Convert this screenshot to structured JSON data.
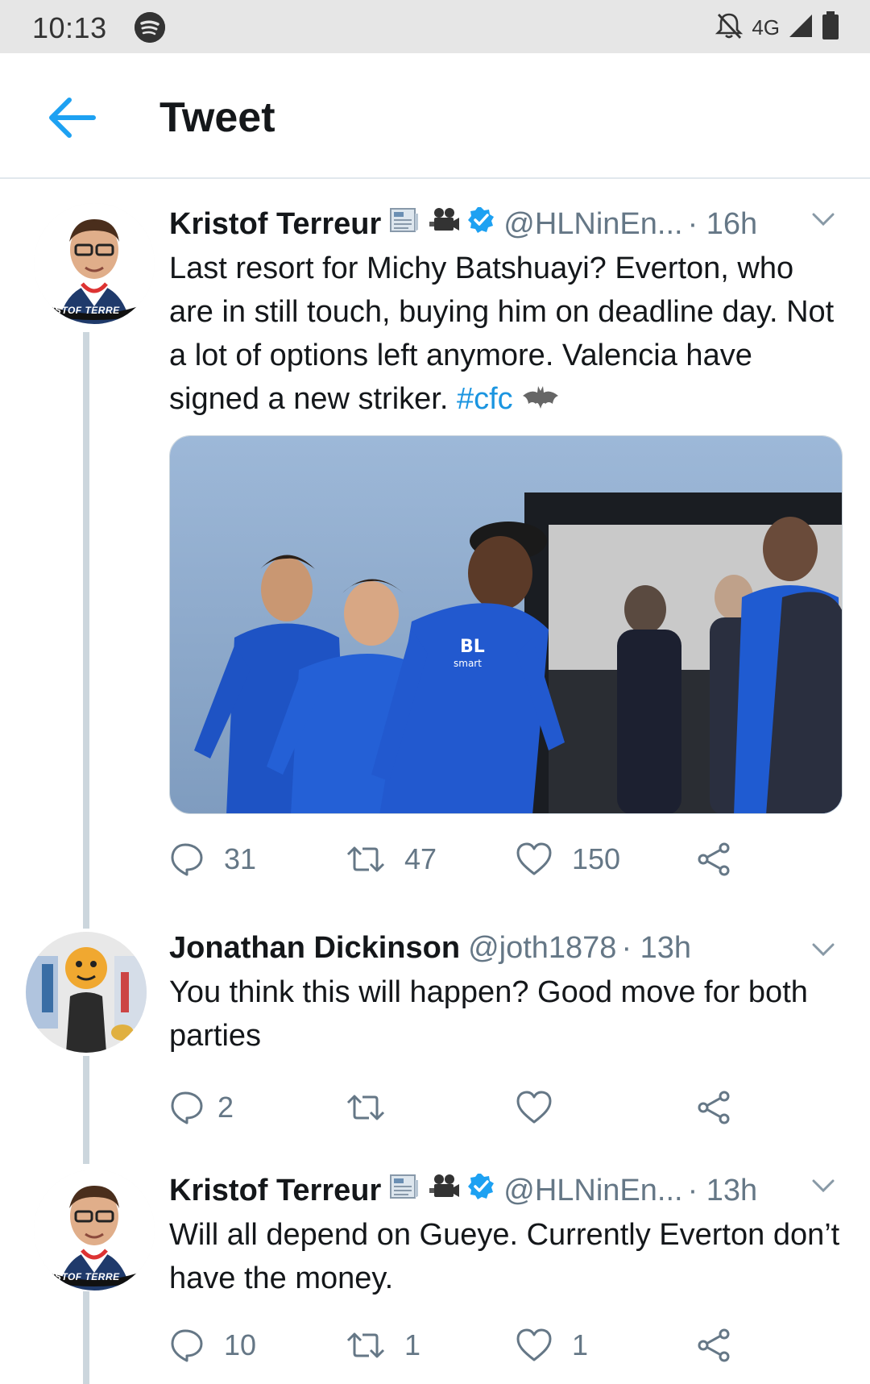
{
  "status_bar": {
    "time": "10:13",
    "network": "4G",
    "icons": [
      "spotify-icon",
      "notifications-off-icon",
      "signal-icon",
      "battery-icon"
    ]
  },
  "header": {
    "title": "Tweet",
    "back_icon": "back-arrow-icon"
  },
  "colors": {
    "accent": "#1da1f2",
    "link": "#1b95e0",
    "secondary_text": "#657786",
    "thread_line": "#ccd6dd"
  },
  "tweets": [
    {
      "name": "Kristof Terreur",
      "badges": [
        "newspaper-emoji",
        "movie-camera-emoji",
        "verified-icon"
      ],
      "handle": "@HLNinEn...",
      "time": "· 16h",
      "text": "Last resort for Michy Batshuayi? Everton, who are in still touch, buying him on deadline day. Not a lot of options left anymore. Valencia have signed a new striker. ",
      "hashtag": "#cfc",
      "trailing_emoji": "bat-emoji",
      "avatar_caption": "ISTOF TERRE",
      "has_media": true,
      "replies": "31",
      "retweets": "47",
      "likes": "150"
    },
    {
      "name": "Jonathan Dickinson",
      "handle": "@joth1878",
      "time": "· 13h",
      "text": "You think this will happen? Good move for both parties",
      "replies": "2",
      "retweets": "",
      "likes": ""
    },
    {
      "name": "Kristof Terreur",
      "badges": [
        "newspaper-emoji",
        "movie-camera-emoji",
        "verified-icon"
      ],
      "handle": "@HLNinEn...",
      "time": "· 13h",
      "text": "Will all depend on Gueye. Currently Everton don’t have the money.",
      "avatar_caption": "ISTOF TERRE",
      "replies": "10",
      "retweets": "1",
      "likes": "1"
    }
  ]
}
